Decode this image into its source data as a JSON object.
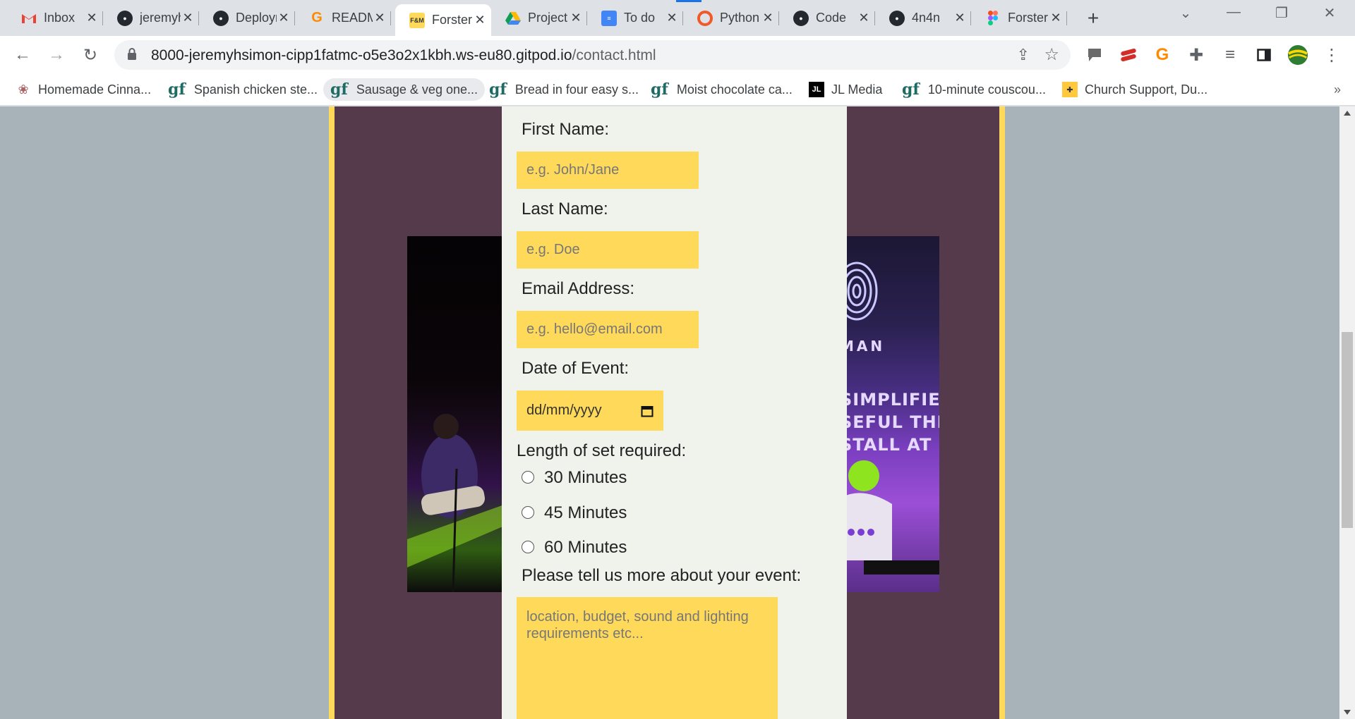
{
  "browser": {
    "tabs": [
      {
        "title": "Inbox",
        "icon": "gmail-icon",
        "color": "#ea4335"
      },
      {
        "title": "jeremyhsimon",
        "icon": "github-icon",
        "color": "#24292f"
      },
      {
        "title": "Deployment",
        "icon": "github-icon",
        "color": "#24292f"
      },
      {
        "title": "README",
        "icon": "gitpod-icon",
        "color": "#ff8a00"
      },
      {
        "title": "Forster",
        "icon": "fm-icon",
        "color": "#ffd95a",
        "active": true
      },
      {
        "title": "Project",
        "icon": "drive-icon",
        "color": "#34a853"
      },
      {
        "title": "To do",
        "icon": "docs-icon",
        "color": "#4285f4"
      },
      {
        "title": "Python",
        "icon": "python-icon",
        "color": "#f05a28"
      },
      {
        "title": "Code",
        "icon": "github-icon",
        "color": "#24292f"
      },
      {
        "title": "4n4n",
        "icon": "github-icon",
        "color": "#24292f"
      },
      {
        "title": "Forster",
        "icon": "figma-icon",
        "color": "#a259ff"
      }
    ],
    "url_host": "8000-jeremyhsimon-cipp1fatmc-o5e3o2x1kbh.ws-eu80.gitpod.io",
    "url_path": "/contact.html",
    "bookmarks": [
      {
        "label": "Homemade Cinna...",
        "icon": "cinnamon-icon"
      },
      {
        "label": "Spanish chicken ste...",
        "icon": "gf-icon"
      },
      {
        "label": "Sausage & veg one...",
        "icon": "gf-icon"
      },
      {
        "label": "Bread in four easy s...",
        "icon": "gf-icon"
      },
      {
        "label": "Moist chocolate ca...",
        "icon": "gf-icon"
      },
      {
        "label": "JL Media",
        "icon": "jl-icon"
      },
      {
        "label": "10-minute couscou...",
        "icon": "gf-icon"
      },
      {
        "label": "Church Support, Du...",
        "icon": "church-icon"
      }
    ],
    "bookmarks_more": "»"
  },
  "page": {
    "colors": {
      "accent": "#ffd95a",
      "panel": "#f0f2ec",
      "band": "#543a4b",
      "background": "#a8b2b9"
    },
    "photo_text": [
      "MAN",
      "SIMPLIFIED I",
      "SEFUL THEY",
      "STALL AT"
    ],
    "form": {
      "first_name_label": "First Name:",
      "first_name_placeholder": "e.g. John/Jane",
      "last_name_label": "Last Name:",
      "last_name_placeholder": "e.g. Doe",
      "email_label": "Email Address:",
      "email_placeholder": "e.g. hello@email.com",
      "date_label": "Date of Event:",
      "date_placeholder": "dd/mm/yyyy",
      "set_length_label": "Length of set required:",
      "set_options": [
        "30 Minutes",
        "45 Minutes",
        "60 Minutes"
      ],
      "more_label": "Please tell us more about your event:",
      "more_placeholder": "location, budget, sound and lighting requirements etc..."
    }
  }
}
